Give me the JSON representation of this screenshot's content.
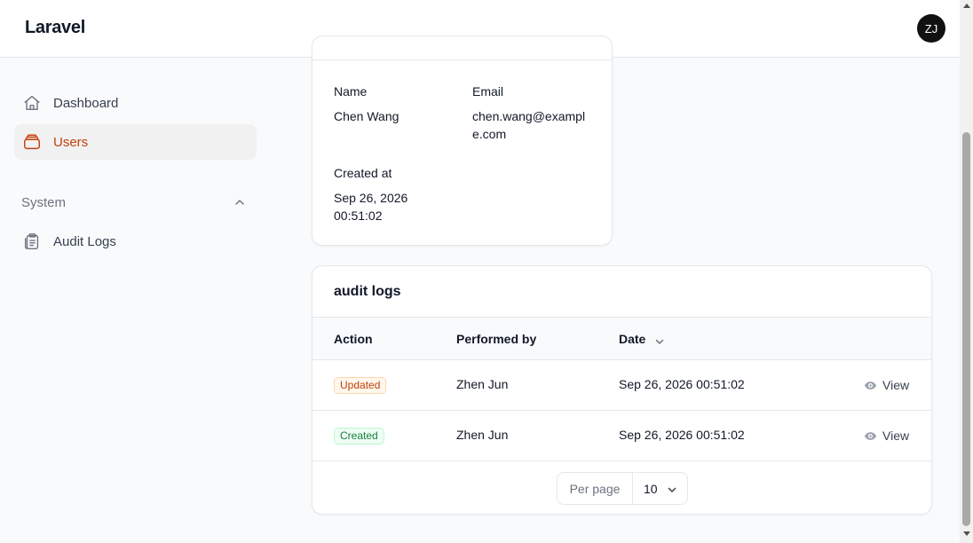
{
  "app": {
    "brand": "Laravel",
    "avatar_initials": "ZJ"
  },
  "sidebar": {
    "items": [
      {
        "label": "Dashboard",
        "icon": "home-icon",
        "active": false
      },
      {
        "label": "Users",
        "icon": "users-stack-icon",
        "active": true
      }
    ],
    "group": {
      "label": "System",
      "icon": "chevron-up-icon",
      "items": [
        {
          "label": "Audit Logs",
          "icon": "clipboard-icon"
        }
      ]
    }
  },
  "user_details": {
    "name_label": "Name",
    "name": "Chen Wang",
    "email_label": "Email",
    "email": "chen.wang@example.com",
    "created_label": "Created at",
    "created_date": "Sep 26, 2026",
    "created_time": "00:51:02"
  },
  "audit_logs": {
    "title": "audit logs",
    "columns": [
      "Action",
      "Performed by",
      "Date"
    ],
    "rows": [
      {
        "action": "Updated",
        "performed_by": "Zhen Jun",
        "date": "Sep 26, 2026 00:51:02",
        "view": "View"
      },
      {
        "action": "Created",
        "performed_by": "Zhen Jun",
        "date": "Sep 26, 2026 00:51:02",
        "view": "View"
      }
    ],
    "per_page_label": "Per page",
    "per_page_value": "10"
  },
  "colors": {
    "accent": "#c2410c",
    "updated_badge": "#c2410c",
    "created_badge": "#15803d"
  }
}
